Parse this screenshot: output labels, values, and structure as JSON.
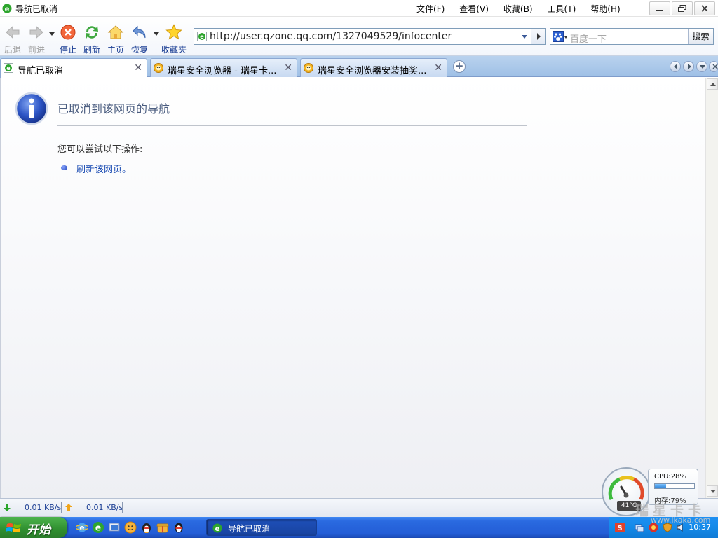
{
  "window": {
    "title": "导航已取消",
    "menus": [
      {
        "label": "文件",
        "key": "F"
      },
      {
        "label": "查看",
        "key": "V"
      },
      {
        "label": "收藏",
        "key": "B"
      },
      {
        "label": "工具",
        "key": "T"
      },
      {
        "label": "帮助",
        "key": "H"
      }
    ]
  },
  "toolbar": {
    "back_label": "后退",
    "forward_label": "前进",
    "stop_label": "停止",
    "refresh_label": "刷新",
    "home_label": "主页",
    "restore_label": "恢复",
    "favorites_label": "收藏夹"
  },
  "address": {
    "url": "http://user.qzone.qq.com/1327049529/infocenter"
  },
  "search": {
    "placeholder": "百度一下",
    "button_label": "搜索"
  },
  "tabs": [
    {
      "title": "导航已取消",
      "active": true
    },
    {
      "title": "瑞星安全浏览器 - 瑞星卡...",
      "active": false
    },
    {
      "title": "瑞星安全浏览器安装抽奖...",
      "active": false
    }
  ],
  "page": {
    "error_title": "已取消到该网页的导航",
    "suggestion_label": "您可以尝试以下操作:",
    "refresh_link": "刷新该网页。"
  },
  "status": {
    "download_speed": "0.01 KB/s",
    "upload_speed": "0.01 KB/s"
  },
  "widget": {
    "cpu_label": "CPU:28%",
    "cpu_percent": 28,
    "mem_label": "内存:79%",
    "temperature": "41°C"
  },
  "taskbar": {
    "start_label": "开始",
    "task_label": "导航已取消",
    "clock": "10:37"
  },
  "watermark": {
    "brand": "瑞星卡卡",
    "url": "www.ikaka.com"
  },
  "colors": {
    "link": "#1f4fb4",
    "title_text": "#4c5e80",
    "taskbar": "#235dd6",
    "start_button": "#2f8f2f"
  }
}
